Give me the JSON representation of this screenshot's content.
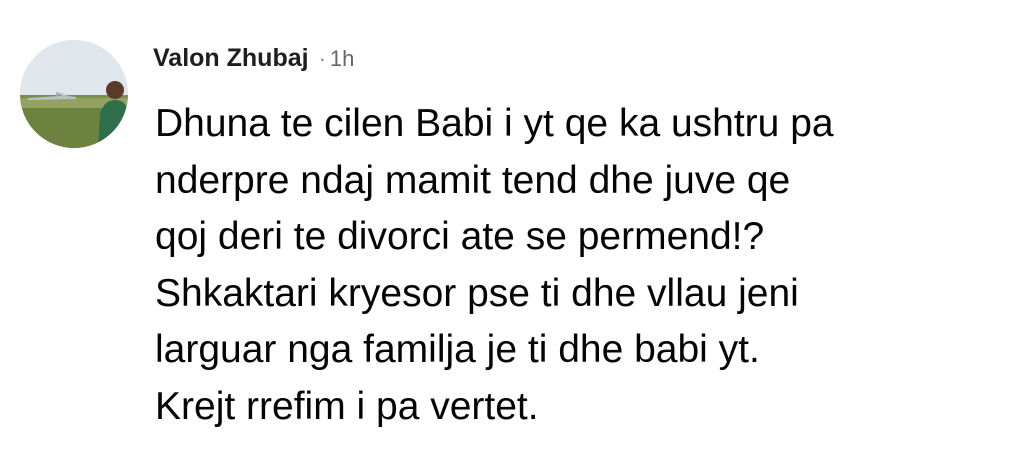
{
  "comment": {
    "author": "Valon Zhubaj",
    "separator": "·",
    "time": "1h",
    "avatar_icon": "profile-photo-icon",
    "lines": [
      "Dhuna te cilen Babi i yt qe ka ushtru pa",
      "nderpre ndaj mamit tend dhe juve qe",
      "qoj deri te divorci ate se permend!?",
      "Shkaktari kryesor pse ti dhe vllau jeni",
      "larguar nga familja je ti dhe babi yt.",
      "Krejt rrefim i pa vertet."
    ]
  }
}
